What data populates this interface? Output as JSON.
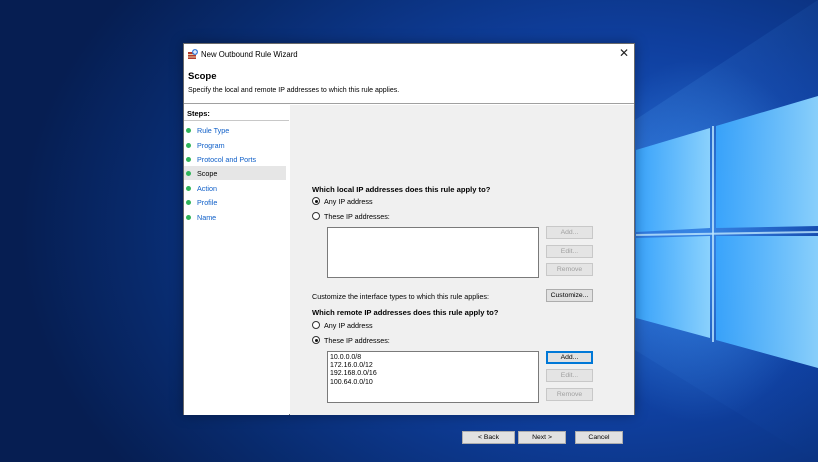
{
  "window": {
    "title": "New Outbound Rule Wizard",
    "close_glyph": "✕"
  },
  "header": {
    "title": "Scope",
    "subtitle": "Specify the local and remote IP addresses to which this rule applies."
  },
  "steps": {
    "label": "Steps:",
    "items": [
      {
        "label": "Rule Type"
      },
      {
        "label": "Program"
      },
      {
        "label": "Protocol and Ports"
      },
      {
        "label": "Scope"
      },
      {
        "label": "Action"
      },
      {
        "label": "Profile"
      },
      {
        "label": "Name"
      }
    ],
    "active": "Scope",
    "dot_color": "#2fb45a"
  },
  "local": {
    "question": "Which local IP addresses does this rule apply to?",
    "any_label": "Any IP address",
    "these_label": "These IP addresses:",
    "selected": "any",
    "addresses": [],
    "add_label": "Add...",
    "edit_label": "Edit...",
    "remove_label": "Remove"
  },
  "interface": {
    "text": "Customize the interface types to which this rule applies:",
    "button_label": "Customize..."
  },
  "remote": {
    "question": "Which remote IP addresses does this rule apply to?",
    "any_label": "Any IP address",
    "these_label": "These IP addresses:",
    "selected": "these",
    "addresses": [
      "10.0.0.0/8",
      "172.16.0.0/12",
      "192.168.0.0/16",
      "100.64.0.0/10"
    ],
    "add_label": "Add...",
    "edit_label": "Edit...",
    "remove_label": "Remove"
  },
  "footer": {
    "back_label": "< Back",
    "next_label": "Next >",
    "cancel_label": "Cancel"
  },
  "colors": {
    "link": "#0f5fc8",
    "focus_border": "#0078d7",
    "desktop": "#0b2f7a"
  }
}
